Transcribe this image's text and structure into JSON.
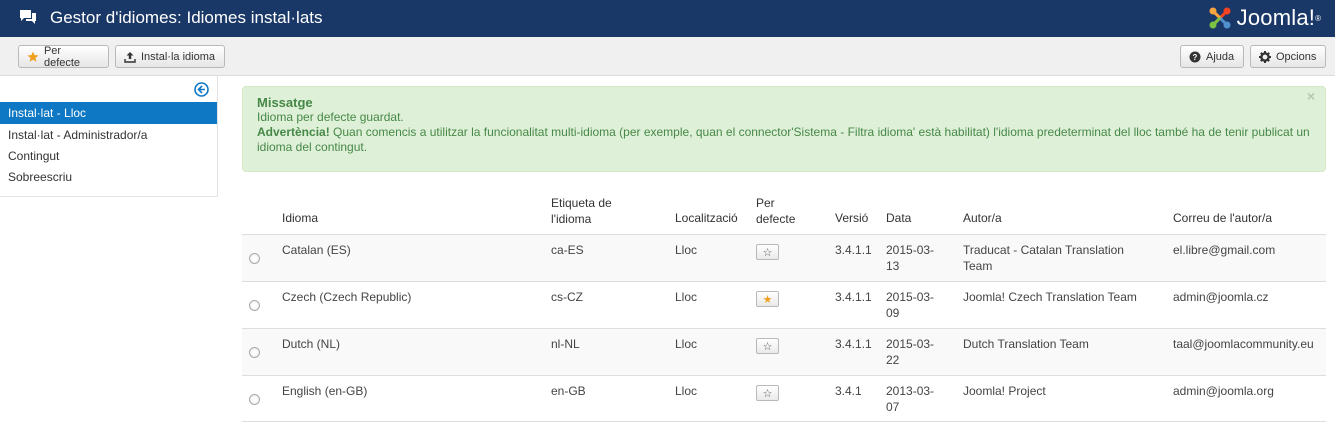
{
  "header": {
    "title": "Gestor d'idiomes: Idiomes instal·lats",
    "brand": "Joomla!",
    "brand_reg": "®"
  },
  "toolbar": {
    "default_label": "Per defecte",
    "install_label": "Instal·la idioma",
    "help_label": "Ajuda",
    "options_label": "Opcions"
  },
  "sidebar": {
    "items": [
      {
        "label": "Instal·lat - Lloc",
        "active": true
      },
      {
        "label": "Instal·lat - Administrador/a",
        "active": false
      },
      {
        "label": "Contingut",
        "active": false
      },
      {
        "label": "Sobreescriu",
        "active": false
      }
    ]
  },
  "alert": {
    "title": "Missatge",
    "line1": "Idioma per defecte guardat.",
    "warning_label": "Advertència!",
    "warning_text": " Quan comencis a utilitzar la funcionalitat multi-idioma (per exemple, quan el connector'Sistema - Filtra idioma' està habilitat) l'idioma predeterminat del lloc també ha de tenir publicat un idioma del contingut.",
    "close": "×"
  },
  "table": {
    "headers": {
      "language": "Idioma",
      "tag_line1": "Etiqueta de",
      "tag_line2": "l'idioma",
      "location": "Localització",
      "default_line1": "Per",
      "default_line2": "defecte",
      "version": "Versió",
      "date": "Data",
      "author": "Autor/a",
      "email": "Correu de l'autor/a"
    },
    "rows": [
      {
        "language": "Catalan (ES)",
        "tag": "ca-ES",
        "location": "Lloc",
        "is_default": false,
        "version": "3.4.1.1",
        "date_1": "2015-03-",
        "date_2": "13",
        "author_1": "Traducat - Catalan Translation",
        "author_2": "Team",
        "email": "el.libre@gmail.com"
      },
      {
        "language": "Czech (Czech Republic)",
        "tag": "cs-CZ",
        "location": "Lloc",
        "is_default": true,
        "version": "3.4.1.1",
        "date_1": "2015-03-",
        "date_2": "09",
        "author_1": "Joomla! Czech Translation Team",
        "author_2": "",
        "email": "admin@joomla.cz"
      },
      {
        "language": "Dutch (NL)",
        "tag": "nl-NL",
        "location": "Lloc",
        "is_default": false,
        "version": "3.4.1.1",
        "date_1": "2015-03-",
        "date_2": "22",
        "author_1": "Dutch Translation Team",
        "author_2": "",
        "email": "taal@joomlacommunity.eu"
      },
      {
        "language": "English (en-GB)",
        "tag": "en-GB",
        "location": "Lloc",
        "is_default": false,
        "version": "3.4.1",
        "date_1": "2013-03-",
        "date_2": "07",
        "author_1": "Joomla! Project",
        "author_2": "",
        "email": "admin@joomla.org"
      }
    ]
  },
  "colors": {
    "header_bg": "#1a3867",
    "sidebar_active": "#0e78c4",
    "alert_bg": "#dff0d8",
    "alert_text": "#468847",
    "star_active": "#f0a020"
  }
}
